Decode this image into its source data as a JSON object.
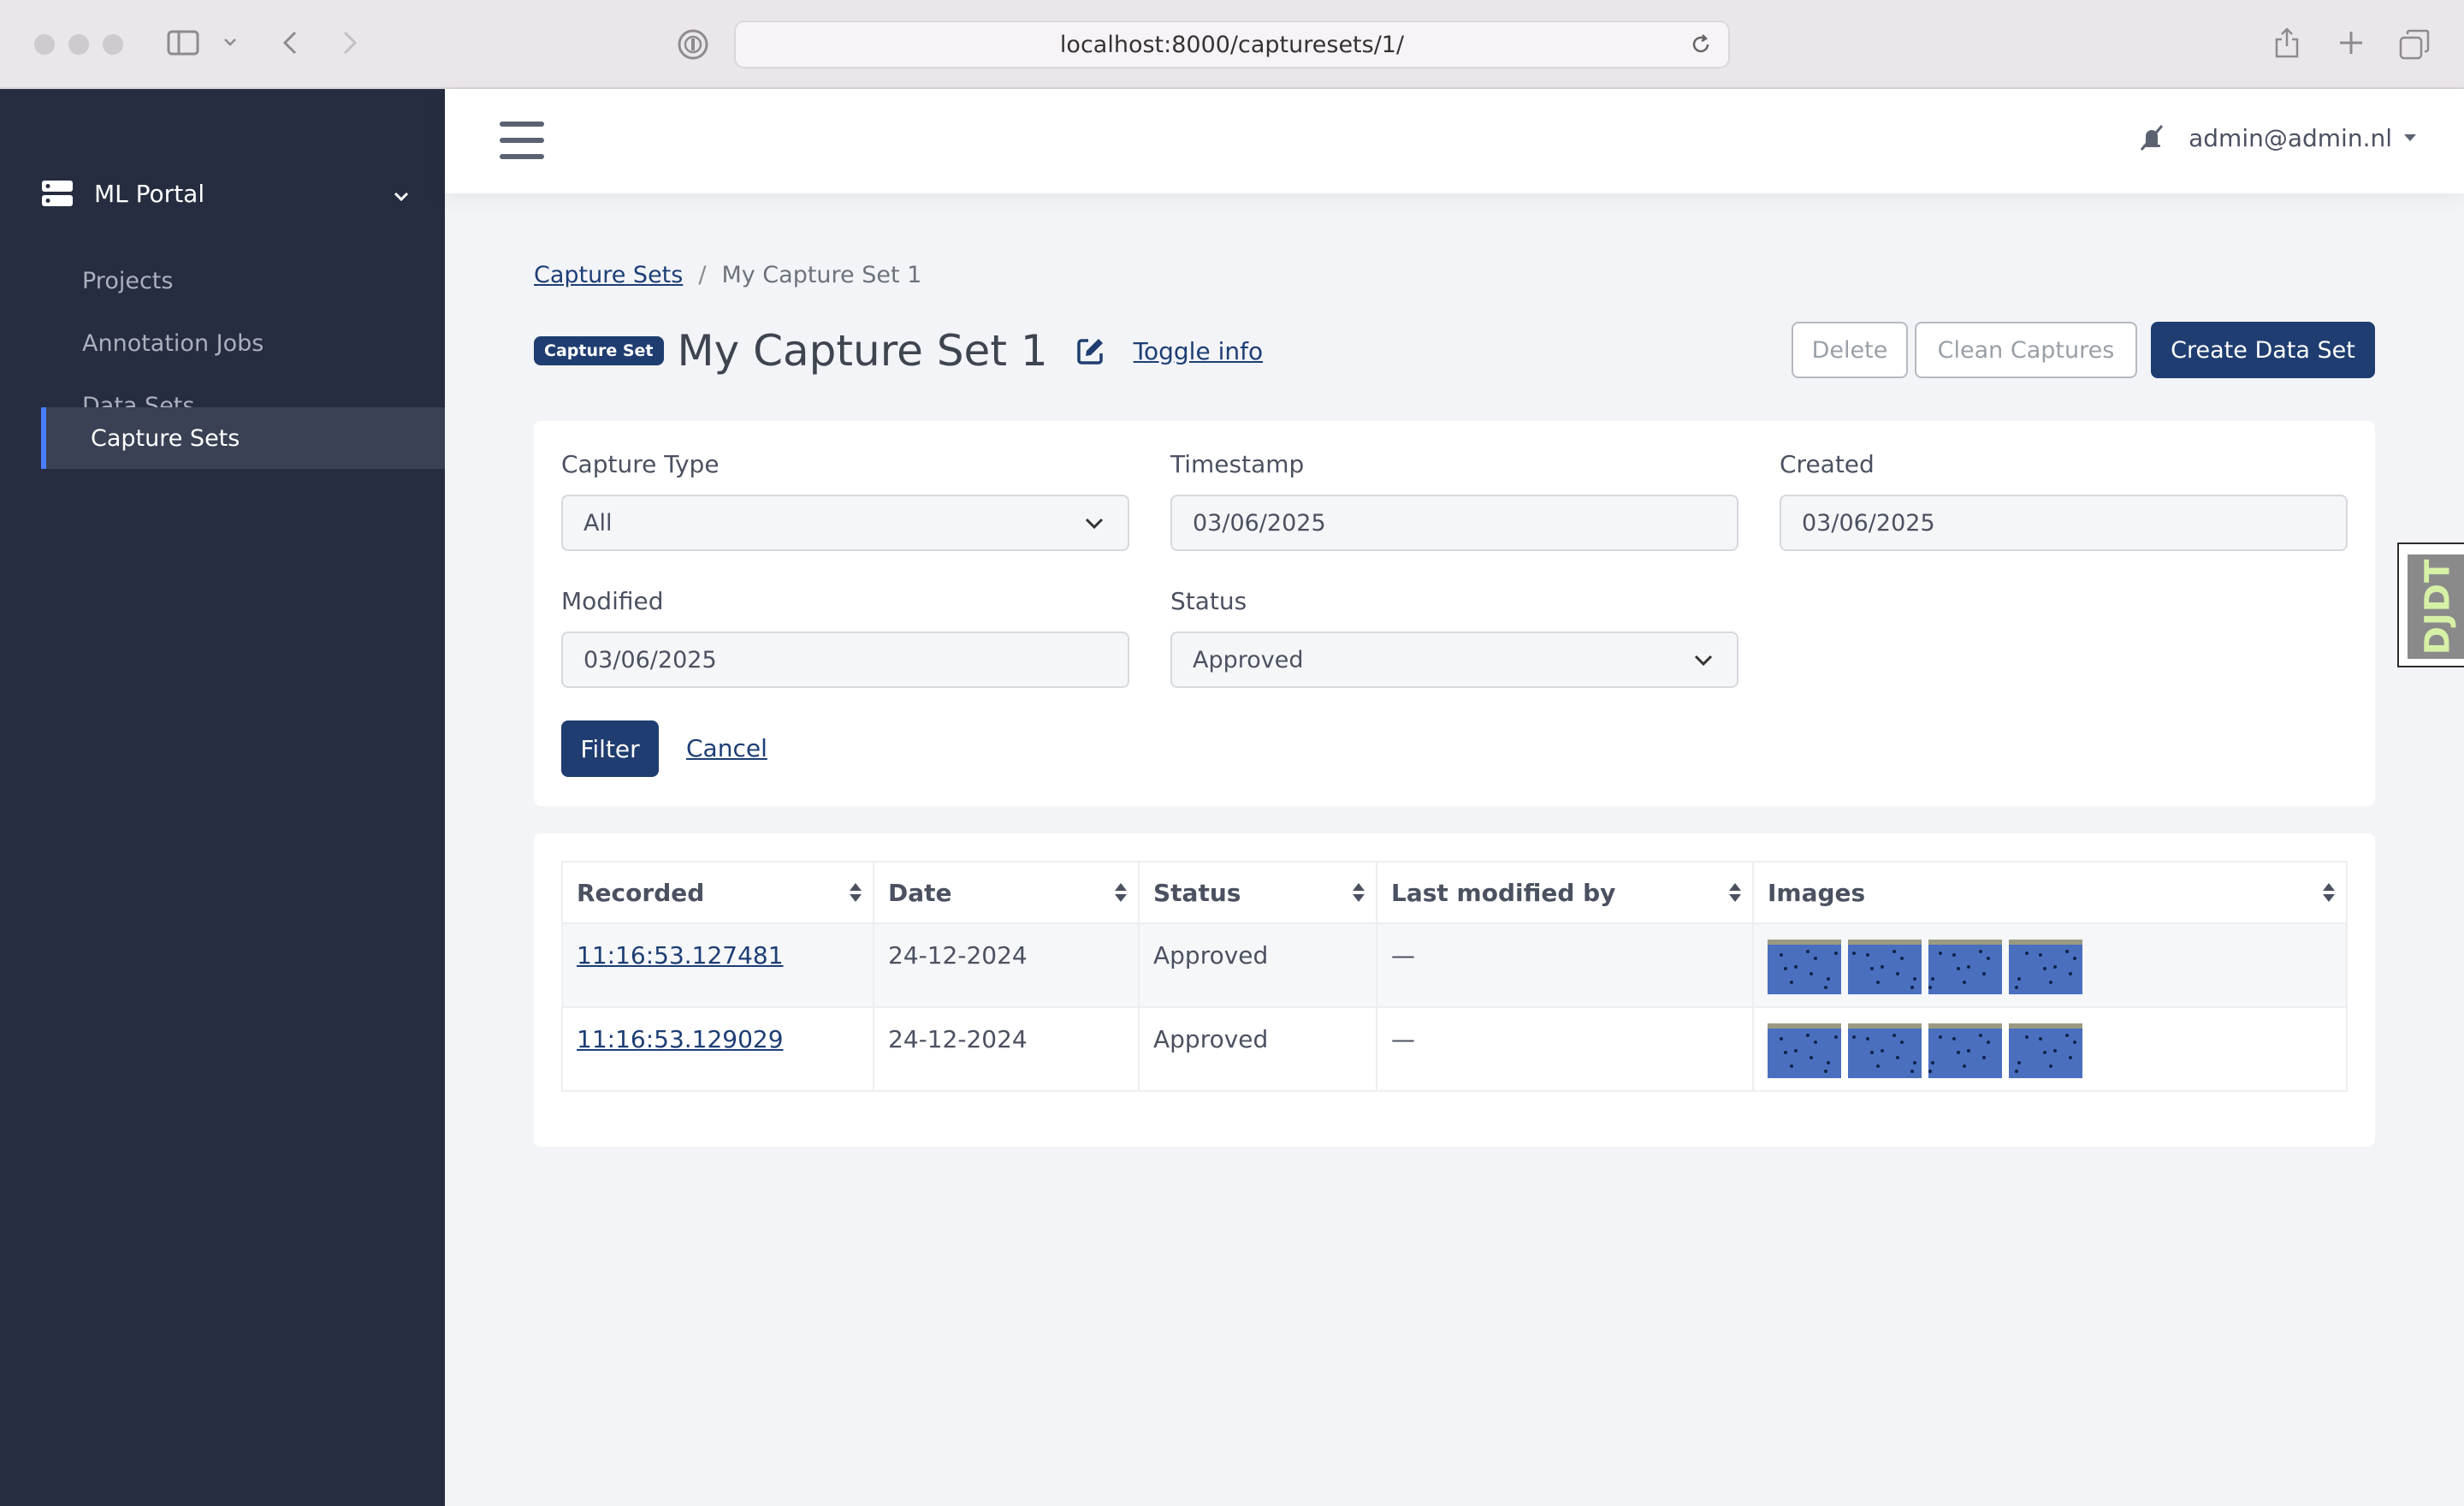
{
  "browser": {
    "url": "localhost:8000/capturesets/1/"
  },
  "sidebar": {
    "brand": "ML Portal",
    "items": [
      {
        "label": "Projects"
      },
      {
        "label": "Annotation Jobs"
      },
      {
        "label": "Data Sets"
      },
      {
        "label": "Capture Sets",
        "active": true
      }
    ]
  },
  "topbar": {
    "user": "admin@admin.nl"
  },
  "breadcrumb": {
    "parent": "Capture Sets",
    "separator": "/",
    "current": "My Capture Set 1"
  },
  "header": {
    "badge": "Capture Set",
    "title": "My Capture Set 1",
    "toggle_info": "Toggle info",
    "delete_label": "Delete",
    "clean_label": "Clean Captures",
    "create_label": "Create Data Set"
  },
  "filters": {
    "capture_type": {
      "label": "Capture Type",
      "value": "All"
    },
    "timestamp": {
      "label": "Timestamp",
      "value": "03/06/2025"
    },
    "created": {
      "label": "Created",
      "value": "03/06/2025"
    },
    "modified": {
      "label": "Modified",
      "value": "03/06/2025"
    },
    "status": {
      "label": "Status",
      "value": "Approved"
    },
    "filter_label": "Filter",
    "cancel_label": "Cancel"
  },
  "table": {
    "columns": [
      "Recorded",
      "Date",
      "Status",
      "Last modified by",
      "Images"
    ],
    "rows": [
      {
        "recorded": "11:16:53.127481",
        "date": "24-12-2024",
        "status": "Approved",
        "modified_by": "—",
        "image_count": 4
      },
      {
        "recorded": "11:16:53.129029",
        "date": "24-12-2024",
        "status": "Approved",
        "modified_by": "—",
        "image_count": 4
      }
    ]
  },
  "djdt": {
    "label": "DJDT"
  },
  "colors": {
    "sidebar_bg": "#262d40",
    "accent": "#1f3d70",
    "active_bar": "#4a7dff"
  }
}
